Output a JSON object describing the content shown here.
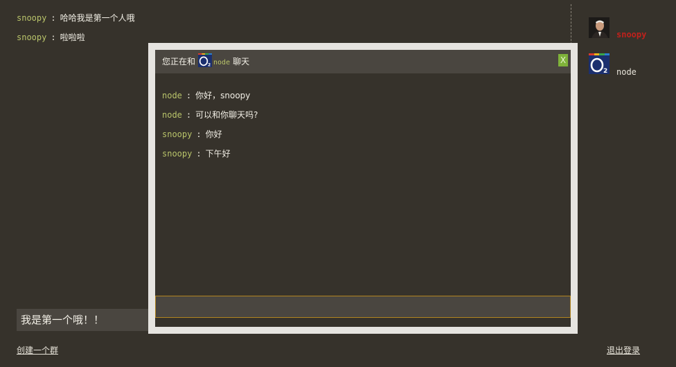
{
  "room_messages": [
    {
      "nick": "snoopy",
      "sep": ":",
      "text": "哈哈我是第一个人哦"
    },
    {
      "nick": "snoopy",
      "sep": ":",
      "text": "啦啦啦"
    }
  ],
  "users": [
    {
      "name": "snoopy",
      "avatar": "portrait-avatar",
      "color": "#c0211c"
    },
    {
      "name": "node",
      "avatar": "o2-logo-avatar"
    }
  ],
  "main_input": {
    "value": "我是第一个哦！！"
  },
  "footer": {
    "create_group": "创建一个群",
    "logout": "退出登录"
  },
  "dialog": {
    "title_prefix": "您正在和",
    "partner": "node",
    "title_suffix": "聊天",
    "close_label": "X",
    "messages": [
      {
        "nick": "node",
        "sep": ":",
        "text": "你好，snoopy"
      },
      {
        "nick": "node",
        "sep": ":",
        "text": "可以和你聊天吗?"
      },
      {
        "nick": "snoopy",
        "sep": ":",
        "text": "你好"
      },
      {
        "nick": "snoopy",
        "sep": ":",
        "text": "下午好"
      }
    ],
    "input_value": ""
  }
}
